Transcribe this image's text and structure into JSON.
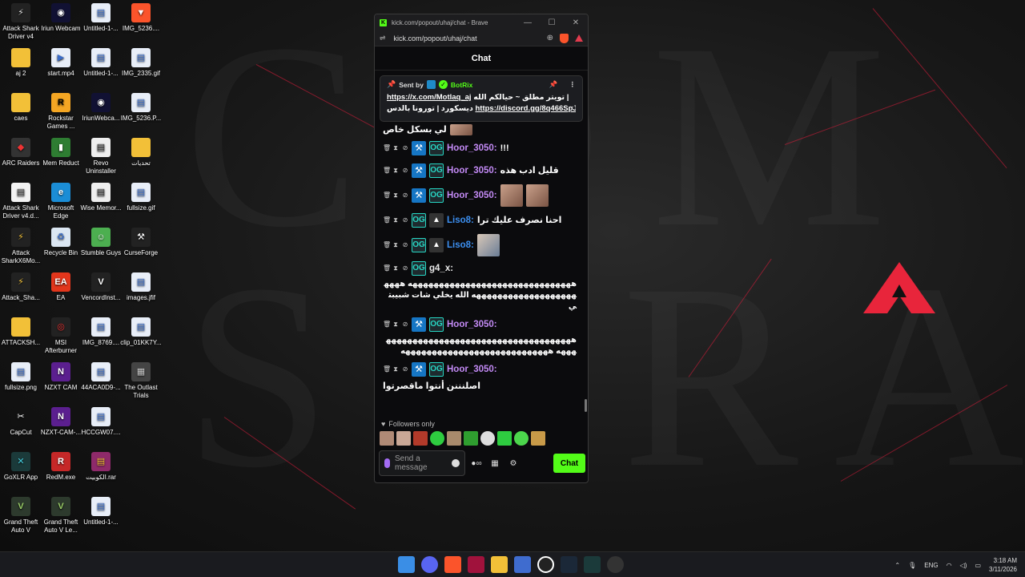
{
  "desktop": {
    "icons": [
      {
        "label": "Attack Shark Driver v4",
        "bg": "#222",
        "glyph": "⚡",
        "color": "#ddd"
      },
      {
        "label": "Iriun Webcam",
        "bg": "#113",
        "glyph": "◉",
        "color": "#fff"
      },
      {
        "label": "Untitled-1-...",
        "bg": "#e8eef8",
        "glyph": "▤",
        "color": "#3a6cc8"
      },
      {
        "label": "IMG_5236....",
        "bg": "#fb542b",
        "glyph": "▼",
        "color": "#fff"
      },
      {
        "label": "aj 2",
        "bg": "#f2c038",
        "glyph": "",
        "color": "#000"
      },
      {
        "label": "start.mp4",
        "bg": "#e8eef8",
        "glyph": "▶",
        "color": "#3a6cc8"
      },
      {
        "label": "Untitled-1-...",
        "bg": "#e8eef8",
        "glyph": "▤",
        "color": "#3a6cc8"
      },
      {
        "label": "IMG_2335.gif",
        "bg": "#e8eef8",
        "glyph": "▤",
        "color": "#3a6cc8"
      },
      {
        "label": "caes",
        "bg": "#f2c038",
        "glyph": "",
        "color": "#000"
      },
      {
        "label": "Rockstar Games ...",
        "bg": "#f5a623",
        "glyph": "R",
        "color": "#000"
      },
      {
        "label": "IriunWebca...",
        "bg": "#113",
        "glyph": "◉",
        "color": "#fff"
      },
      {
        "label": "IMG_5236.P...",
        "bg": "#e8eef8",
        "glyph": "▤",
        "color": "#3a6cc8"
      },
      {
        "label": "ARC Raiders",
        "bg": "#333",
        "glyph": "◆",
        "color": "#e33"
      },
      {
        "label": "Mem Reduct",
        "bg": "#2e7d32",
        "glyph": "▮",
        "color": "#fff"
      },
      {
        "label": "Revo Uninstaller",
        "bg": "#eee",
        "glyph": "▤",
        "color": "#333"
      },
      {
        "label": "تحديات",
        "bg": "#f2c038",
        "glyph": "",
        "color": "#000"
      },
      {
        "label": "Attack Shark Driver v4.d...",
        "bg": "#f4f4f4",
        "glyph": "▤",
        "color": "#444"
      },
      {
        "label": "Microsoft Edge",
        "bg": "#1b8dd6",
        "glyph": "e",
        "color": "#fff"
      },
      {
        "label": "Wise Memor...",
        "bg": "#eee",
        "glyph": "▤",
        "color": "#333"
      },
      {
        "label": "fullsize.gif",
        "bg": "#e8eef8",
        "glyph": "▤",
        "color": "#3a6cc8"
      },
      {
        "label": "Attack SharkX6Mo...",
        "bg": "#222",
        "glyph": "⚡",
        "color": "#f2c038"
      },
      {
        "label": "Recycle Bin",
        "bg": "#dbe6f2",
        "glyph": "♻",
        "color": "#3a6cc8"
      },
      {
        "label": "Stumble Guys",
        "bg": "#4caf50",
        "glyph": "☺",
        "color": "#fff"
      },
      {
        "label": "CurseForge",
        "bg": "#222",
        "glyph": "⚒",
        "color": "#fff"
      },
      {
        "label": "Attack_Sha...",
        "bg": "#222",
        "glyph": "⚡",
        "color": "#f2c038"
      },
      {
        "label": "EA",
        "bg": "#e2361c",
        "glyph": "EA",
        "color": "#fff"
      },
      {
        "label": "VencordInst...",
        "bg": "#222",
        "glyph": "V",
        "color": "#fff"
      },
      {
        "label": "images.jfif",
        "bg": "#e8eef8",
        "glyph": "▤",
        "color": "#3a6cc8"
      },
      {
        "label": "ATTACKSH...",
        "bg": "#f2c038",
        "glyph": "",
        "color": "#000"
      },
      {
        "label": "MSI Afterburner",
        "bg": "#222",
        "glyph": "◎",
        "color": "#e33"
      },
      {
        "label": "IMG_8769....",
        "bg": "#e8eef8",
        "glyph": "▤",
        "color": "#3a6cc8"
      },
      {
        "label": "clip_01KK7Y...",
        "bg": "#e8eef8",
        "glyph": "▤",
        "color": "#3a6cc8"
      },
      {
        "label": "fullsize.png",
        "bg": "#e8eef8",
        "glyph": "▤",
        "color": "#3a6cc8"
      },
      {
        "label": "NZXT CAM",
        "bg": "#5b1f8f",
        "glyph": "N",
        "color": "#fff"
      },
      {
        "label": "44ACA0D9-...",
        "bg": "#e8eef8",
        "glyph": "▤",
        "color": "#3a6cc8"
      },
      {
        "label": "The Outlast Trials",
        "bg": "#444",
        "glyph": "▦",
        "color": "#ccc"
      },
      {
        "label": "CapCut",
        "bg": "#111",
        "glyph": "✂",
        "color": "#fff"
      },
      {
        "label": "NZXT-CAM-...",
        "bg": "#5b1f8f",
        "glyph": "N",
        "color": "#fff"
      },
      {
        "label": "HCCGW07....",
        "bg": "#e8eef8",
        "glyph": "▤",
        "color": "#3a6cc8"
      },
      {
        "label": "",
        "bg": "transparent",
        "glyph": "",
        "color": "#000"
      },
      {
        "label": "GoXLR App",
        "bg": "#1b3a3a",
        "glyph": "✕",
        "color": "#4cd"
      },
      {
        "label": "RedM.exe",
        "bg": "#c62828",
        "glyph": "R",
        "color": "#fff"
      },
      {
        "label": "الكوبيت.rar",
        "bg": "#8e2a6a",
        "glyph": "▤",
        "color": "#f2c038"
      },
      {
        "label": "",
        "bg": "transparent",
        "glyph": "",
        "color": "#000"
      },
      {
        "label": "Grand Theft Auto V",
        "bg": "#2d3a2d",
        "glyph": "V",
        "color": "#9c6"
      },
      {
        "label": "Grand Theft Auto V Le...",
        "bg": "#2d3a2d",
        "glyph": "V",
        "color": "#9c6"
      },
      {
        "label": "Untitled-1-...",
        "bg": "#e8eef8",
        "glyph": "▤",
        "color": "#3a6cc8"
      }
    ]
  },
  "browser": {
    "title": "kick.com/popout/uhaj/chat - Brave",
    "url": "kick.com/popout/uhaj/chat"
  },
  "chat": {
    "header": "Chat",
    "pinned": {
      "sent_by": "Sent by",
      "author": "BotRix",
      "line1_link": "https://x.com/Motlaq_aj",
      "line1_text": "تويتر مطلق ~ حيالكم الله |",
      "line2_link": "https://discord.gg/8q466SpJ...",
      "line2_text": "ديسكورد | تورونا بالدس"
    },
    "partial_text": "لي بسكل خاص",
    "messages": [
      {
        "user": "Hoor_3050:",
        "text": "!!!",
        "color": "purple",
        "badges": [
          "hammer",
          "og"
        ],
        "mod": true,
        "emotes": 0
      },
      {
        "user": "Hoor_3050:",
        "text": "قليل ادب هذه",
        "color": "purple",
        "badges": [
          "hammer",
          "og"
        ],
        "mod": true,
        "emotes": 0
      },
      {
        "user": "Hoor_3050:",
        "text": "",
        "color": "purple",
        "badges": [
          "hammer",
          "og"
        ],
        "mod": true,
        "emotes": 2
      },
      {
        "user": "Liso8:",
        "text": "احنا نصرف عليك ترا",
        "color": "blue",
        "badges": [
          "og",
          "apex"
        ],
        "mod": true,
        "emotes": 0
      },
      {
        "user": "Liso8:",
        "text": "",
        "color": "blue",
        "badges": [
          "og",
          "apex"
        ],
        "mod": true,
        "emotes": 1
      },
      {
        "user": "g4_x:",
        "text": "هههههههههههههههههههههههههههههههه هههههههههههههههههههههههه الله يخلي شات شبيبتي",
        "color": "white",
        "badges": [
          "og"
        ],
        "mod": true,
        "emotes": 0,
        "long": true
      },
      {
        "user": "Hoor_3050:",
        "text": "هههههههههههههههههههههههههههههههههههههههه ههههههههههههههههههههههههههههه",
        "color": "purple",
        "badges": [
          "hammer",
          "og"
        ],
        "mod": true,
        "emotes": 0,
        "long": true
      },
      {
        "user": "Hoor_3050:",
        "text": "اصلنننن أنتوا ماقصرتوا",
        "color": "purple",
        "badges": [
          "hammer",
          "og"
        ],
        "mod": true,
        "emotes": 0
      }
    ],
    "followers_only": "Followers only",
    "input_placeholder": "Send a message",
    "send_button": "Chat"
  },
  "taskbar": {
    "lang": "ENG",
    "time": "3:18 AM",
    "date": "3/11/2026"
  },
  "colors": {
    "kick_green": "#53fc18",
    "accent_red": "#e23b4e"
  }
}
